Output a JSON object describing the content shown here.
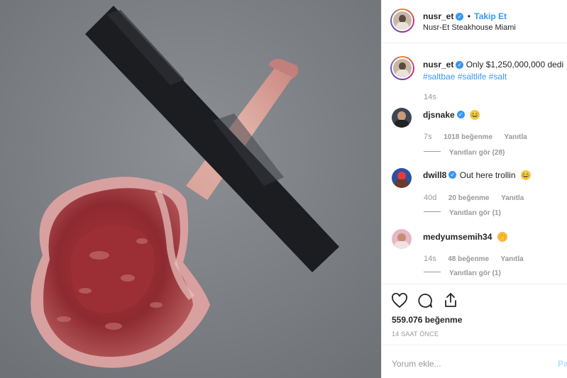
{
  "post": {
    "username": "nusr_et",
    "follow_label": "Takip Et",
    "location": "Nusr-Et Steakhouse Miami",
    "caption": {
      "username": "nusr_et",
      "text": "Only $1,250,000,000 dedi",
      "hashtags": "#saltbae #saltlife #salt",
      "time": "14s"
    },
    "likes_label": "559.076 beğenme",
    "time_ago": "14 SAAT ÖNCE",
    "comment_placeholder": "Yorum ekle...",
    "post_button": "Pa"
  },
  "comments": [
    {
      "username": "djsnake",
      "text": "",
      "time": "7s",
      "likes": "1018 beğenme",
      "reply": "Yanıtla",
      "view_replies": "Yanıtları gör (28)",
      "emoji": "rofl"
    },
    {
      "username": "dwill8",
      "text": "Out here trollin",
      "time": "40d",
      "likes": "20 beğenme",
      "reply": "Yanıtla",
      "view_replies": "Yanıtları gör (1)",
      "emoji": "rofl"
    },
    {
      "username": "medyumsemih34",
      "text": "",
      "time": "14s",
      "likes": "48 beğenme",
      "reply": "Yanıtla",
      "view_replies": "Yanıtları gör (1)",
      "emoji": "clap"
    }
  ],
  "icons": {
    "like": "heart-icon",
    "comment": "comment-icon",
    "share": "share-icon"
  },
  "colors": {
    "link_blue": "#3897f0",
    "verified_blue": "#3897f0",
    "tape": "#1c1d20",
    "background_photo": "#7b7e83"
  }
}
